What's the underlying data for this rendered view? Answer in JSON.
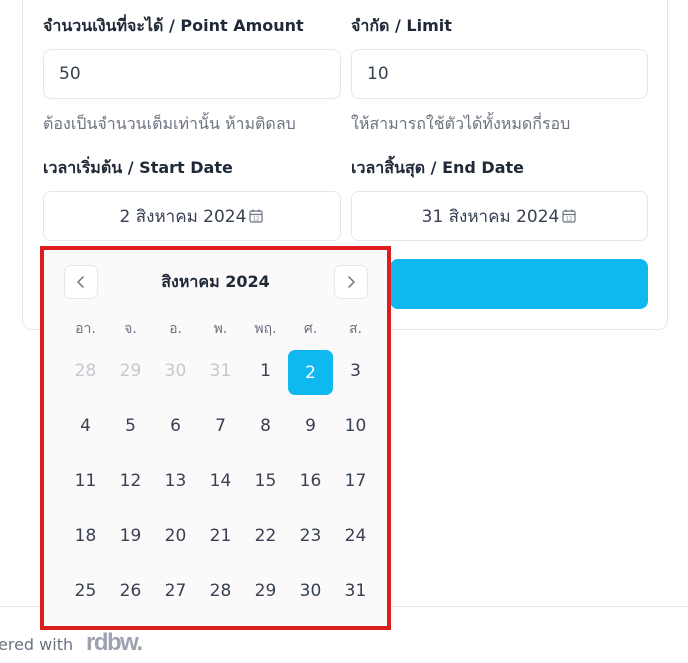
{
  "form": {
    "point_amount_label": "จำนวนเงินที่จะได้ / Point Amount",
    "point_amount_value": "50",
    "point_amount_hint": "ต้องเป็นจำนวนเต็มเท่านั้น ห้ามติดลบ",
    "limit_label": "จำกัด / Limit",
    "limit_value": "10",
    "limit_hint": "ให้สามารถใช้ตัวได้ทั้งหมดกี่รอบ",
    "start_date_label": "เวลาเริ่มต้น / Start Date",
    "start_date_value": "2 สิงหาคม 2024",
    "end_date_label": "เวลาสิ้นสุด / End Date",
    "end_date_value": "31 สิงหาคม 2024"
  },
  "calendar": {
    "month_title": "สิงหาคม 2024",
    "weekdays": [
      "อา.",
      "จ.",
      "อ.",
      "พ.",
      "พฤ.",
      "ศ.",
      "ส."
    ],
    "days": [
      {
        "label": "28",
        "muted": true
      },
      {
        "label": "29",
        "muted": true
      },
      {
        "label": "30",
        "muted": true
      },
      {
        "label": "31",
        "muted": true
      },
      {
        "label": "1"
      },
      {
        "label": "2",
        "selected": true
      },
      {
        "label": "3"
      },
      {
        "label": "4"
      },
      {
        "label": "5"
      },
      {
        "label": "6"
      },
      {
        "label": "7"
      },
      {
        "label": "8"
      },
      {
        "label": "9"
      },
      {
        "label": "10"
      },
      {
        "label": "11"
      },
      {
        "label": "12"
      },
      {
        "label": "13"
      },
      {
        "label": "14"
      },
      {
        "label": "15"
      },
      {
        "label": "16"
      },
      {
        "label": "17"
      },
      {
        "label": "18"
      },
      {
        "label": "19"
      },
      {
        "label": "20"
      },
      {
        "label": "21"
      },
      {
        "label": "22"
      },
      {
        "label": "23"
      },
      {
        "label": "24"
      },
      {
        "label": "25"
      },
      {
        "label": "26"
      },
      {
        "label": "27"
      },
      {
        "label": "28"
      },
      {
        "label": "29"
      },
      {
        "label": "30"
      },
      {
        "label": "31"
      }
    ],
    "prev_icon": "chevron-left-icon",
    "next_icon": "chevron-right-icon"
  },
  "footer": {
    "powered_text": "ered with",
    "logo_text": "rdbw."
  },
  "colors": {
    "accent": "#10b8f0",
    "highlight_border": "#dc1e1e"
  }
}
